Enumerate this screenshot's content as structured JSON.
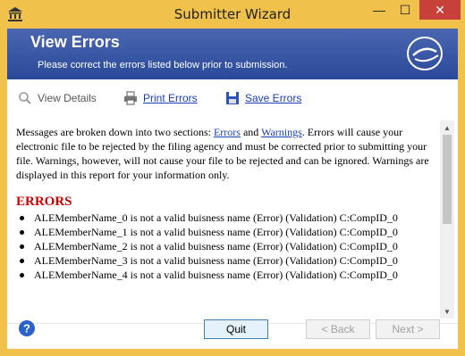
{
  "window": {
    "title": "Submitter Wizard",
    "minimize_glyph": "—",
    "maximize_glyph": "☐",
    "close_glyph": "✕"
  },
  "header": {
    "title": "View Errors",
    "subtitle": "Please correct the errors listed below prior to submission."
  },
  "toolbar": {
    "view_details": "View Details",
    "print_errors": "Print Errors",
    "save_errors": "Save Errors"
  },
  "content": {
    "intro_part1": "Messages are broken down into two sections: ",
    "errors_link": "Errors",
    "and_text": " and ",
    "warnings_link": "Warnings",
    "intro_part2": ". Errors will cause your electronic file to be rejected by the filing agency and must be corrected prior to submitting your file. Warnings, however, will not cause your file to be rejected and can be ignored. Warnings are displayed in this report for your information only.",
    "errors_heading": "ERRORS",
    "errors": [
      "ALEMemberName_0 is not a valid buisness name (Error) (Validation) C:CompID_0",
      "ALEMemberName_1 is not a valid buisness name (Error) (Validation) C:CompID_0",
      "ALEMemberName_2 is not a valid buisness name (Error) (Validation) C:CompID_0",
      "ALEMemberName_3 is not a valid buisness name (Error) (Validation) C:CompID_0",
      "ALEMemberName_4 is not a valid buisness name (Error) (Validation) C:CompID_0"
    ]
  },
  "buttons": {
    "quit": "Quit",
    "back": "< Back",
    "next": "Next >"
  },
  "colors": {
    "frame": "#f0c14b",
    "header": "#2a4a99",
    "link": "#1a3db5",
    "error_heading": "#cc0000"
  }
}
